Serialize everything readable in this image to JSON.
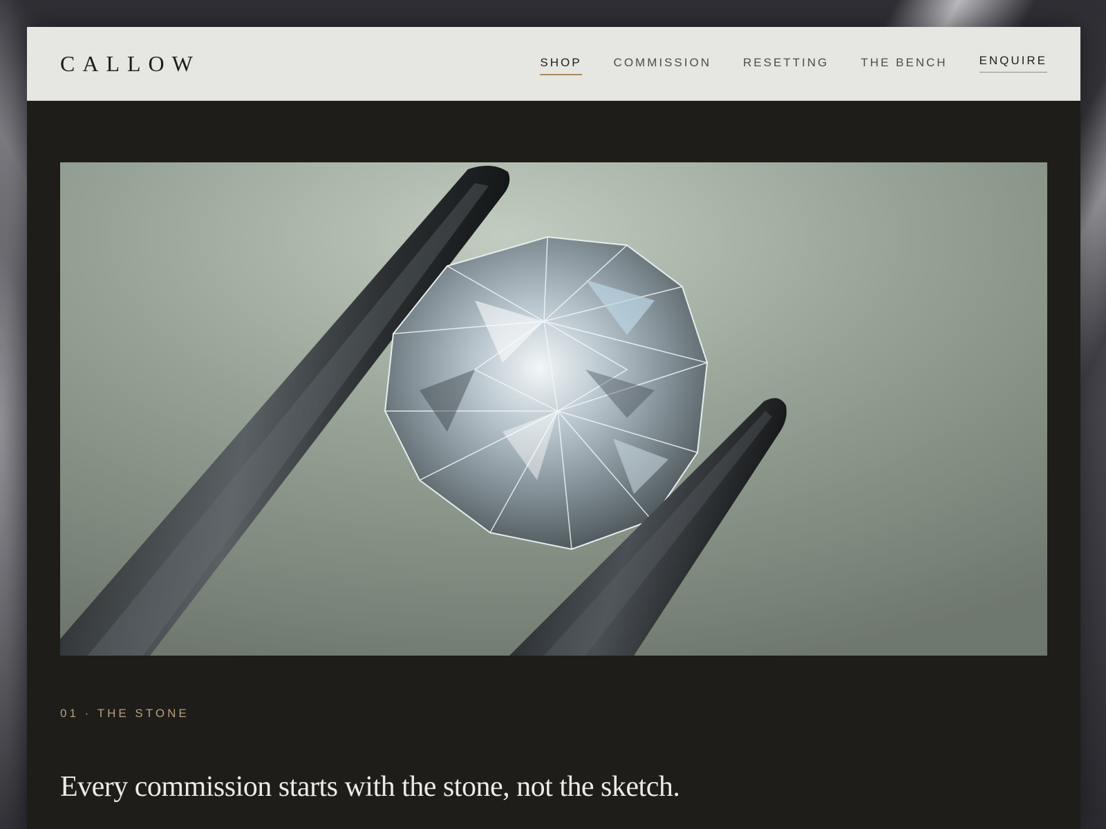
{
  "brand": {
    "logo": "CALLOW"
  },
  "nav": {
    "items": [
      {
        "label": "SHOP",
        "active": true
      },
      {
        "label": "COMMISSION",
        "active": false
      },
      {
        "label": "RESETTING",
        "active": false
      },
      {
        "label": "THE BENCH",
        "active": false
      }
    ],
    "enquire": "ENQUIRE"
  },
  "hero": {
    "image": "diamond-held-in-tweezers"
  },
  "section": {
    "eyebrow": "01 · THE STONE",
    "headline": "Every commission starts with the stone, not the sketch."
  },
  "colors": {
    "header_bg": "#e6e6e2",
    "page_bg": "#1e1d19",
    "accent": "#a98a5c",
    "eyebrow": "#b8a07c",
    "headline": "#ecebe6"
  }
}
